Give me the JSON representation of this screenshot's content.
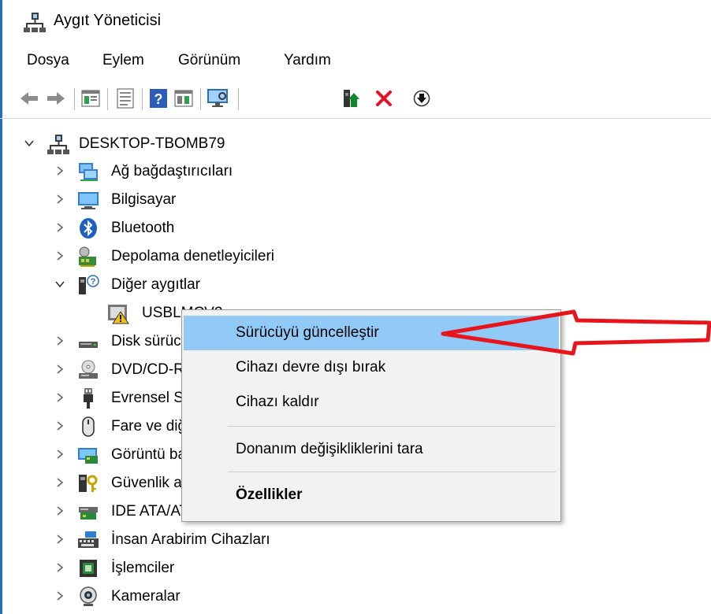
{
  "window": {
    "title": "Aygıt Yöneticisi",
    "icon": "device-manager-icon"
  },
  "menu": [
    "Dosya",
    "Eylem",
    "Görünüm",
    "Yardım"
  ],
  "toolbar": {
    "buttons": [
      "back-arrow-icon",
      "forward-arrow-icon",
      "properties-view-icon",
      "list-view-icon",
      "help-icon",
      "details-view-icon",
      "monitor-scan-icon",
      "update-driver-icon",
      "uninstall-x-icon",
      "download-icon"
    ],
    "colors": {
      "uninstall": "#e81123",
      "update": "#0a8a2a"
    }
  },
  "tree": {
    "root": {
      "label": "DESKTOP-TBOMB79",
      "expanded": true
    },
    "items": [
      {
        "label": "Ağ bağdaştırıcıları",
        "icon": "network-adapter-icon",
        "expanded": false
      },
      {
        "label": "Bilgisayar",
        "icon": "computer-icon",
        "expanded": false
      },
      {
        "label": "Bluetooth",
        "icon": "bluetooth-icon",
        "expanded": false
      },
      {
        "label": "Depolama denetleyicileri",
        "icon": "storage-controller-icon",
        "expanded": false
      },
      {
        "label": "Diğer aygıtlar",
        "icon": "other-devices-icon",
        "expanded": true
      },
      {
        "label": "USBLMCV2",
        "icon": "warning-device-icon",
        "child": true
      },
      {
        "label": "Disk sürücüleri",
        "icon": "disk-drive-icon",
        "expanded": false
      },
      {
        "label": "DVD/CD-ROM sürücüleri",
        "icon": "dvd-drive-icon",
        "expanded": false
      },
      {
        "label": "Evrensel Seri Veri Yolu denetleyicileri",
        "icon": "usb-icon",
        "expanded": false
      },
      {
        "label": "Fare ve diğer işaret aygıtları",
        "icon": "mouse-icon",
        "expanded": false
      },
      {
        "label": "Görüntü bağdaştırıcıları",
        "icon": "display-adapter-icon",
        "expanded": false
      },
      {
        "label": "Güvenlik aygıtları",
        "icon": "security-device-icon",
        "expanded": false
      },
      {
        "label": "IDE ATA/ATAPI denetleyicileri",
        "icon": "ide-controller-icon",
        "expanded": false
      },
      {
        "label": "İnsan Arabirim Cihazları",
        "icon": "hid-icon",
        "expanded": false
      },
      {
        "label": "İşlemciler",
        "icon": "processor-icon",
        "expanded": false
      },
      {
        "label": "Kameralar",
        "icon": "camera-icon",
        "expanded": false
      }
    ]
  },
  "context_menu": {
    "items": [
      {
        "label": "Sürücüyü güncelleştir",
        "highlighted": true
      },
      {
        "label": "Cihazı devre dışı bırak"
      },
      {
        "label": "Cihazı kaldır"
      },
      {
        "label": "Donanım değişikliklerini tara"
      },
      {
        "label": "Özellikler",
        "bold": true
      }
    ]
  },
  "annotation": {
    "color": "#e8141c",
    "shape": "red-arrow-pointing-left"
  }
}
